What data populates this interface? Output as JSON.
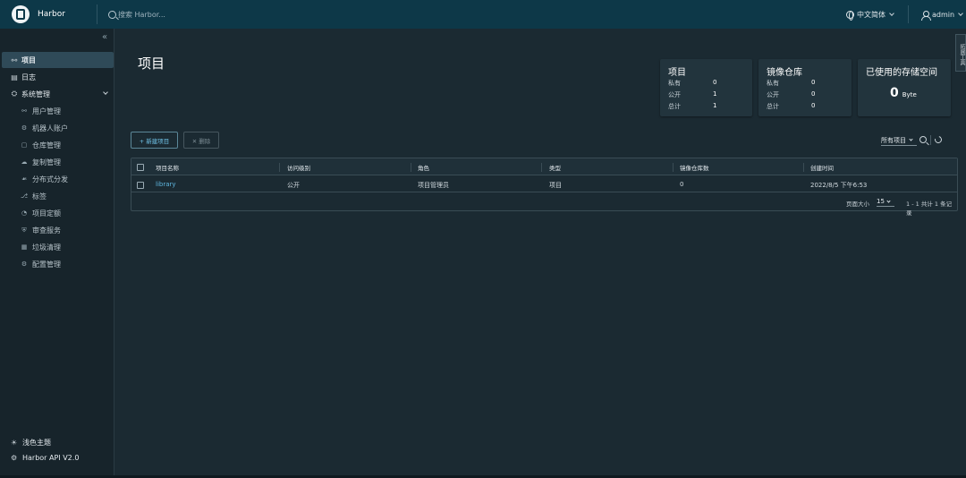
{
  "header": {
    "brand": "Harbor",
    "search_placeholder": "搜索 Harbor...",
    "language": "中文简体",
    "user": "admin"
  },
  "sidebar": {
    "collapse_glyph": "«",
    "items": [
      {
        "label": "项目",
        "icon": "projects-icon"
      },
      {
        "label": "日志",
        "icon": "logs-icon"
      },
      {
        "label": "系统管理",
        "icon": "admin-icon"
      }
    ],
    "sub_items": [
      {
        "label": "用户管理",
        "icon": "users-icon"
      },
      {
        "label": "机器人账户",
        "icon": "robot-icon"
      },
      {
        "label": "仓库管理",
        "icon": "registry-icon"
      },
      {
        "label": "复制管理",
        "icon": "replication-icon"
      },
      {
        "label": "分布式分发",
        "icon": "distribution-icon"
      },
      {
        "label": "标签",
        "icon": "tag-icon"
      },
      {
        "label": "项目定额",
        "icon": "quota-icon"
      },
      {
        "label": "审查服务",
        "icon": "shield-icon"
      },
      {
        "label": "垃圾清理",
        "icon": "trash-icon"
      },
      {
        "label": "配置管理",
        "icon": "gear-icon"
      }
    ],
    "footer": {
      "theme": "浅色主题",
      "api": "Harbor API V2.0"
    }
  },
  "side_tab": "拓展工具",
  "main": {
    "title": "项目",
    "cards": {
      "projects": {
        "title": "项目",
        "rows": [
          {
            "label": "私有",
            "value": "0"
          },
          {
            "label": "公开",
            "value": "1"
          },
          {
            "label": "总计",
            "value": "1"
          }
        ]
      },
      "repos": {
        "title": "镜像仓库",
        "rows": [
          {
            "label": "私有",
            "value": "0"
          },
          {
            "label": "公开",
            "value": "0"
          },
          {
            "label": "总计",
            "value": "0"
          }
        ]
      },
      "storage": {
        "title": "已使用的存储空间",
        "value": "0",
        "unit": "Byte"
      }
    },
    "new_project": "+ 新建项目",
    "delete": "✕ 删除",
    "filter": "所有项目",
    "table": {
      "columns": [
        "项目名称",
        "访问级别",
        "角色",
        "类型",
        "镜像仓库数",
        "创建时间"
      ],
      "rows": [
        [
          "library",
          "公开",
          "项目管理员",
          "项目",
          "0",
          "2022/8/5 下午6:53"
        ]
      ],
      "page_size_label": "页面大小",
      "page_size": "15",
      "summary": "1 - 1 共计 1 条记录"
    }
  }
}
